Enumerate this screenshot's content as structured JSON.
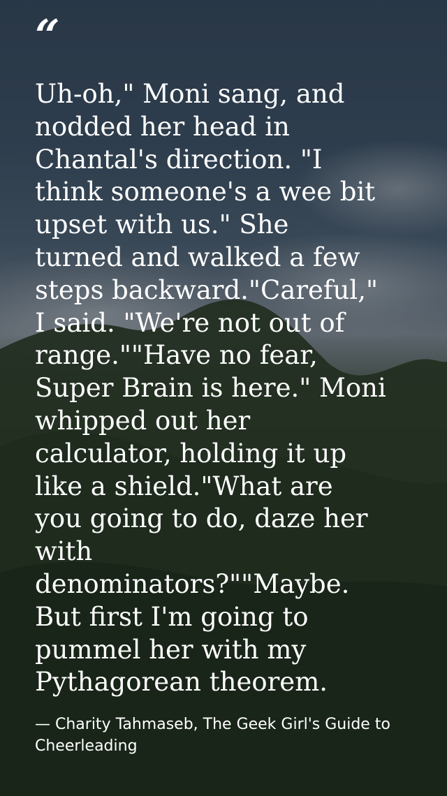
{
  "quote": {
    "mark": "“",
    "text": "Uh-oh,\" Moni sang, and\nnodded her head in\nChantal's direction. \"I\nthink someone's a wee bit\nupset with us.\" She\nturned and walked a few\nsteps backward.\"Careful,\"\nI said. \"We're not out of\nrange.\"\"Have no fear,\nSuper Brain is here.\" Moni\nwhipped out her\ncalculator, holding it up\nlike a shield.\"What are\nyou going to do, daze her\nwith\ndenominators?\"\"Maybe.\nBut first I'm going to\npummel her with my\nPythagorean theorem.",
    "attribution": "— Charity Tahmaseb, The Geek Girl's Guide to Cheerleading"
  },
  "colors": {
    "text": "#ffffff",
    "sky_top": "#34475a",
    "hills": "#223219"
  }
}
